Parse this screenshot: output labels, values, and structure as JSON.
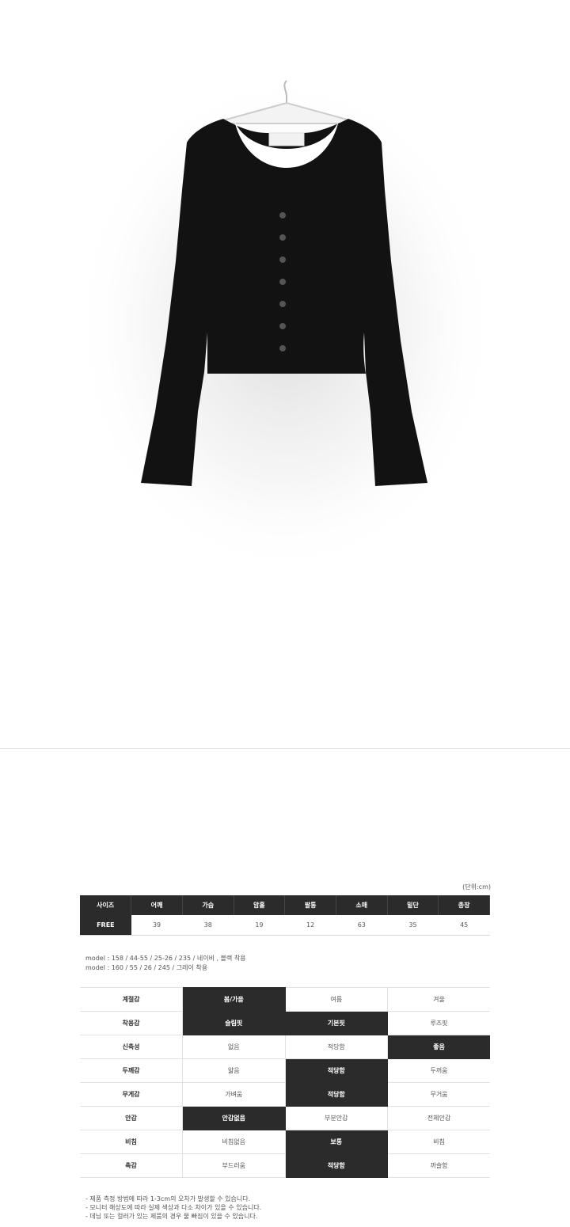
{
  "unit_label": "(단위:cm)",
  "size_table": {
    "headers": [
      "사이즈",
      "어깨",
      "가슴",
      "암홀",
      "팔통",
      "소매",
      "밑단",
      "총장"
    ],
    "rows": [
      [
        "FREE",
        "39",
        "38",
        "19",
        "12",
        "63",
        "35",
        "45"
      ]
    ]
  },
  "model_info": [
    "model : 158 / 44-55 / 25-26 / 235 / 네이비 , 블랙 착용",
    "model : 160 / 55 / 26 / 245 / 그레이 착용"
  ],
  "attributes": [
    {
      "label": "계절감",
      "options": [
        "봄/가을",
        "여름",
        "겨울"
      ],
      "selected": [
        0
      ]
    },
    {
      "label": "착용감",
      "options": [
        "슬림핏",
        "기본핏",
        "루즈핏"
      ],
      "selected": [
        0,
        1
      ]
    },
    {
      "label": "신축성",
      "options": [
        "없음",
        "적당함",
        "좋음"
      ],
      "selected": [
        2
      ]
    },
    {
      "label": "두께감",
      "options": [
        "얇음",
        "적당함",
        "두꺼움"
      ],
      "selected": [
        1
      ]
    },
    {
      "label": "무게감",
      "options": [
        "가벼움",
        "적당함",
        "무거움"
      ],
      "selected": [
        1
      ]
    },
    {
      "label": "안감",
      "options": [
        "안감없음",
        "부분안감",
        "전체안감"
      ],
      "selected": [
        0
      ]
    },
    {
      "label": "비침",
      "options": [
        "비침없음",
        "보통",
        "비침"
      ],
      "selected": [
        1
      ]
    },
    {
      "label": "촉감",
      "options": [
        "부드러움",
        "적당함",
        "까슬함"
      ],
      "selected": [
        1
      ]
    }
  ],
  "notes": [
    "- 제품 측정 방법에 따라 1-3cm의 오차가 발생할 수 있습니다.",
    "- 모니터 해상도에 따라 실제 색상과 다소 차이가 있을 수 있습니다.",
    "- 데님 또는 컬러가 있는 제품의 경우 물 빠짐이 있을 수 있습니다."
  ],
  "colors": {
    "dark_cell": "#2b2b2b",
    "garment": "#111111",
    "border": "#e2e2e2"
  }
}
